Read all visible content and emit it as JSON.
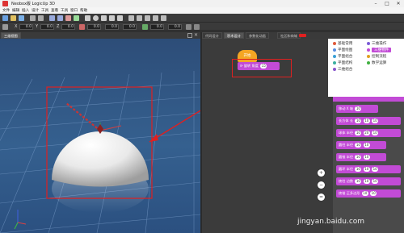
{
  "window": {
    "title": "Neobox版 LogicUp 3D"
  },
  "menubar": {
    "items": [
      "文件",
      "编辑",
      "插入",
      "设计",
      "工具",
      "查看",
      "工具",
      "窗口",
      "帮助"
    ]
  },
  "toolbar2": {
    "x_value": "0.0",
    "y_value": "0.0",
    "z_value": "0.0",
    "rx_value": "0.0",
    "ry_value": "0.0",
    "rz_value": "0.0",
    "sx_value": "0.0",
    "sy_value": "0.0"
  },
  "viewport": {
    "tab_label": "三维视图"
  },
  "right_tabs": [
    "代码设计",
    "积木设计",
    "参数化动画",
    "社区和商城"
  ],
  "editor": {
    "hat_block_label": "开始",
    "action_block_label": "旋转 角度",
    "action_block_value": "15"
  },
  "categories": [
    {
      "label": "基础常用",
      "color": "#e05a3a"
    },
    {
      "label": "三维操作",
      "color": "#7b5cd6"
    },
    {
      "label": "平面绘图",
      "color": "#5a8de0"
    },
    {
      "label": "三维物件",
      "color": "#c24bd6"
    },
    {
      "label": "平面组合",
      "color": "#3aa0d6"
    },
    {
      "label": "控制流程",
      "color": "#e0a020"
    },
    {
      "label": "平面结构",
      "color": "#3ab0a0"
    },
    {
      "label": "数学运算",
      "color": "#40b040"
    },
    {
      "label": "三维组合",
      "color": "#8855cc"
    }
  ],
  "palette_blocks": [
    {
      "label": "移动 X 轴",
      "values": [
        "10"
      ]
    },
    {
      "label": "长方体 长",
      "values": [
        "10",
        "10",
        "10"
      ]
    },
    {
      "label": "球体 半径",
      "values": [
        "10",
        "20",
        "10"
      ]
    },
    {
      "label": "圆柱 半径",
      "values": [
        "10",
        "10"
      ]
    },
    {
      "label": "圆锥 半径",
      "values": [
        "10",
        "10"
      ]
    },
    {
      "label": "圆环 半径",
      "values": [
        "10",
        "10",
        "10"
      ]
    },
    {
      "label": "棱柱 边数",
      "values": [
        "10",
        "10",
        "10"
      ]
    },
    {
      "label": "棱锥 正多边形",
      "values": [
        "10",
        "10"
      ]
    }
  ],
  "zoom_controls": [
    "+",
    "−",
    "="
  ],
  "watermark": "jingyan.baidu.com",
  "colors": {
    "viewport_sky": "#35608f",
    "block_purple": "#c24bd6",
    "hat_orange": "#f5a623",
    "highlight_red": "#e02020"
  }
}
